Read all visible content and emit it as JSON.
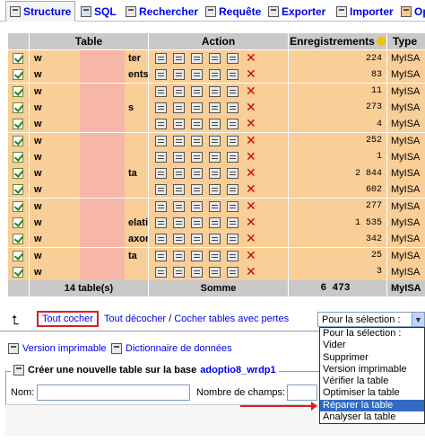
{
  "tabs": [
    {
      "label": "Structure",
      "icon": "structure-icon",
      "active": true
    },
    {
      "label": "SQL",
      "icon": "sql-icon"
    },
    {
      "label": "Rechercher",
      "icon": "search-icon"
    },
    {
      "label": "Requête",
      "icon": "query-icon"
    },
    {
      "label": "Exporter",
      "icon": "export-icon"
    },
    {
      "label": "Importer",
      "icon": "import-icon"
    },
    {
      "label": "Opé",
      "icon": "operations-icon"
    }
  ],
  "table": {
    "headers": {
      "table": "Table",
      "action": "Action",
      "records": "Enregistrements",
      "type": "Type"
    },
    "rows": [
      {
        "name": "w",
        "suffix": "ter",
        "count": "224",
        "type": "MyISA"
      },
      {
        "name": "w",
        "suffix": "ents",
        "count": "83",
        "type": "MyISA"
      },
      {
        "name": "w",
        "suffix": "",
        "count": "11",
        "type": "MyISA"
      },
      {
        "name": "w",
        "suffix": "s",
        "count": "273",
        "type": "MyISA"
      },
      {
        "name": "w",
        "suffix": "",
        "count": "4",
        "type": "MyISA"
      },
      {
        "name": "w",
        "suffix": "",
        "count": "252",
        "type": "MyISA"
      },
      {
        "name": "w",
        "suffix": "",
        "count": "1",
        "type": "MyISA"
      },
      {
        "name": "w",
        "suffix": "ta",
        "count": "2 844",
        "type": "MyISA"
      },
      {
        "name": "w",
        "suffix": "",
        "count": "602",
        "type": "MyISA"
      },
      {
        "name": "w",
        "suffix": "",
        "count": "277",
        "type": "MyISA"
      },
      {
        "name": "w",
        "suffix": "elationships",
        "count": "1 535",
        "type": "MyISA"
      },
      {
        "name": "w",
        "suffix": "axonomy",
        "count": "342",
        "type": "MyISA"
      },
      {
        "name": "w",
        "suffix": "ta",
        "count": "25",
        "type": "MyISA"
      },
      {
        "name": "w",
        "suffix": "",
        "count": "3",
        "type": "MyISA"
      }
    ],
    "footer": {
      "tables": "14 table(s)",
      "sum_label": "Somme",
      "total": "6 473",
      "type": "MyISA"
    }
  },
  "controls": {
    "check_all": "Tout cocher",
    "uncheck_all": "Tout décocher",
    "slash": "/",
    "check_overhead": "Cocher tables avec pertes",
    "selection_value": "Pour la sélection :"
  },
  "dropdown": {
    "options": [
      "Pour la sélection :",
      "Vider",
      "Supprimer",
      "Version imprimable",
      "Vérifier la table",
      "Optimiser la table",
      "Réparer la table",
      "Analyser la table"
    ],
    "highlighted": "Réparer la table"
  },
  "utilities": {
    "print_view": "Version imprimable",
    "data_dictionary": "Dictionnaire de données"
  },
  "create_table": {
    "legend": "Créer une nouvelle table sur la base",
    "database": "adoptio8_wrdp1",
    "name_label": "Nom:",
    "fields_label": "Nombre de champs:"
  }
}
